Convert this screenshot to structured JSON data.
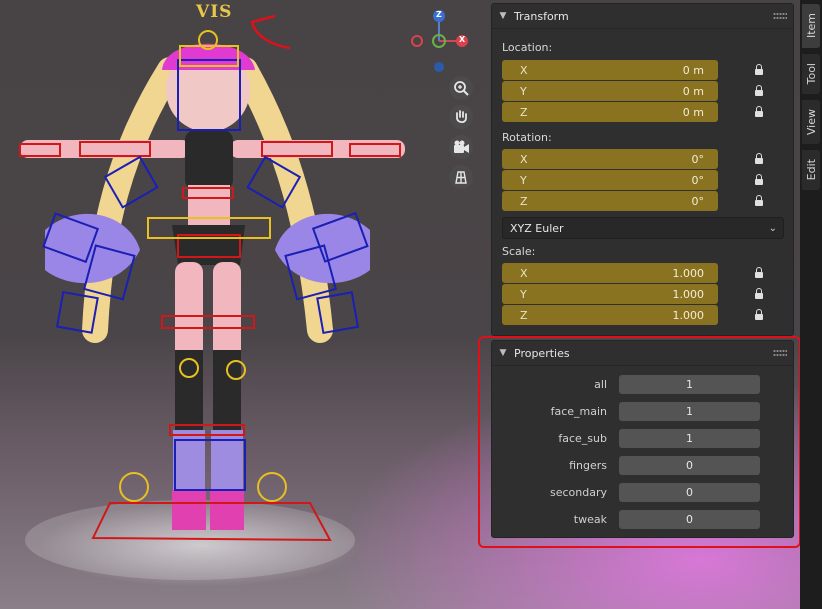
{
  "viewport": {
    "annotation_text": "VIS",
    "gizmo": {
      "z_label": "Z",
      "x_label": "X"
    },
    "nav_buttons": [
      {
        "name": "zoom-icon",
        "glyph": "⊕"
      },
      {
        "name": "hand-pan-icon",
        "glyph": "✋"
      },
      {
        "name": "camera-icon",
        "glyph": "🎥"
      },
      {
        "name": "grid-icon",
        "glyph": "▦"
      }
    ]
  },
  "transform": {
    "title": "Transform",
    "location_label": "Location:",
    "location": [
      {
        "axis": "X",
        "value": "0 m"
      },
      {
        "axis": "Y",
        "value": "0 m"
      },
      {
        "axis": "Z",
        "value": "0 m"
      }
    ],
    "rotation_label": "Rotation:",
    "rotation": [
      {
        "axis": "X",
        "value": "0°"
      },
      {
        "axis": "Y",
        "value": "0°"
      },
      {
        "axis": "Z",
        "value": "0°"
      }
    ],
    "rotation_mode": "XYZ Euler",
    "scale_label": "Scale:",
    "scale": [
      {
        "axis": "X",
        "value": "1.000"
      },
      {
        "axis": "Y",
        "value": "1.000"
      },
      {
        "axis": "Z",
        "value": "1.000"
      }
    ]
  },
  "properties": {
    "title": "Properties",
    "rows": [
      {
        "label": "all",
        "value": "1"
      },
      {
        "label": "face_main",
        "value": "1"
      },
      {
        "label": "face_sub",
        "value": "1"
      },
      {
        "label": "fingers",
        "value": "0"
      },
      {
        "label": "secondary",
        "value": "0"
      },
      {
        "label": "tweak",
        "value": "0"
      }
    ]
  },
  "tabs": [
    "Item",
    "Tool",
    "View",
    "Edit"
  ],
  "colors": {
    "field_gold": "#8a7320",
    "annotation_red": "#e0101a",
    "bone_blue": "#1a1fb5",
    "bone_red": "#d01818",
    "bone_yellow": "#e8c020"
  }
}
